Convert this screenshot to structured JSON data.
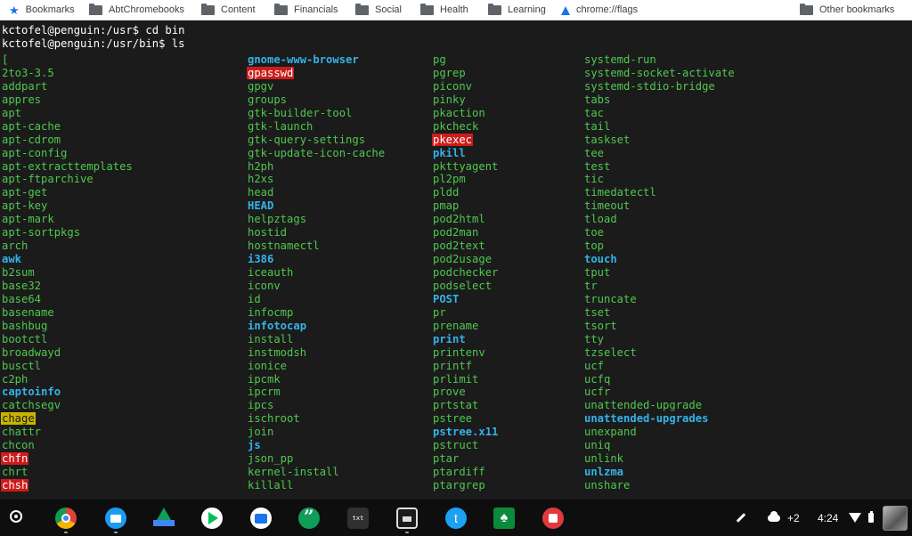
{
  "bookmarks": [
    {
      "label": "Bookmarks",
      "icon": "star-icon"
    },
    {
      "label": "AbtChromebooks",
      "icon": "folder-icon"
    },
    {
      "label": "Content",
      "icon": "folder-icon"
    },
    {
      "label": "Financials",
      "icon": "folder-icon"
    },
    {
      "label": "Social",
      "icon": "folder-icon"
    },
    {
      "label": "Health",
      "icon": "folder-icon"
    },
    {
      "label": "Learning",
      "icon": "folder-icon"
    },
    {
      "label": "chrome://flags",
      "icon": "flask-icon"
    },
    {
      "label": "Other bookmarks",
      "icon": "folder-icon"
    }
  ],
  "terminal": {
    "lines": [
      "kctofel@penguin:/usr$ cd bin",
      "kctofel@penguin:/usr/bin$ ls"
    ],
    "columns": [
      [
        {
          "name": "[",
          "type": "exec"
        },
        {
          "name": "2to3-3.5",
          "type": "exec"
        },
        {
          "name": "addpart",
          "type": "exec"
        },
        {
          "name": "appres",
          "type": "exec"
        },
        {
          "name": "apt",
          "type": "exec"
        },
        {
          "name": "apt-cache",
          "type": "exec"
        },
        {
          "name": "apt-cdrom",
          "type": "exec"
        },
        {
          "name": "apt-config",
          "type": "exec"
        },
        {
          "name": "apt-extracttemplates",
          "type": "exec"
        },
        {
          "name": "apt-ftparchive",
          "type": "exec"
        },
        {
          "name": "apt-get",
          "type": "exec"
        },
        {
          "name": "apt-key",
          "type": "exec"
        },
        {
          "name": "apt-mark",
          "type": "exec"
        },
        {
          "name": "apt-sortpkgs",
          "type": "exec"
        },
        {
          "name": "arch",
          "type": "exec"
        },
        {
          "name": "awk",
          "type": "link"
        },
        {
          "name": "b2sum",
          "type": "exec"
        },
        {
          "name": "base32",
          "type": "exec"
        },
        {
          "name": "base64",
          "type": "exec"
        },
        {
          "name": "basename",
          "type": "exec"
        },
        {
          "name": "bashbug",
          "type": "exec"
        },
        {
          "name": "bootctl",
          "type": "exec"
        },
        {
          "name": "broadwayd",
          "type": "exec"
        },
        {
          "name": "busctl",
          "type": "exec"
        },
        {
          "name": "c2ph",
          "type": "exec"
        },
        {
          "name": "captoinfo",
          "type": "link"
        },
        {
          "name": "catchsegv",
          "type": "exec"
        },
        {
          "name": "chage",
          "type": "sgid"
        },
        {
          "name": "chattr",
          "type": "exec"
        },
        {
          "name": "chcon",
          "type": "exec"
        },
        {
          "name": "chfn",
          "type": "suid"
        },
        {
          "name": "chrt",
          "type": "exec"
        },
        {
          "name": "chsh",
          "type": "suid"
        }
      ],
      [
        {
          "name": "gnome-www-browser",
          "type": "link"
        },
        {
          "name": "gpasswd",
          "type": "suid"
        },
        {
          "name": "gpgv",
          "type": "exec"
        },
        {
          "name": "groups",
          "type": "exec"
        },
        {
          "name": "gtk-builder-tool",
          "type": "exec"
        },
        {
          "name": "gtk-launch",
          "type": "exec"
        },
        {
          "name": "gtk-query-settings",
          "type": "exec"
        },
        {
          "name": "gtk-update-icon-cache",
          "type": "exec"
        },
        {
          "name": "h2ph",
          "type": "exec"
        },
        {
          "name": "h2xs",
          "type": "exec"
        },
        {
          "name": "head",
          "type": "exec"
        },
        {
          "name": "HEAD",
          "type": "link"
        },
        {
          "name": "helpztags",
          "type": "exec"
        },
        {
          "name": "hostid",
          "type": "exec"
        },
        {
          "name": "hostnamectl",
          "type": "exec"
        },
        {
          "name": "i386",
          "type": "link"
        },
        {
          "name": "iceauth",
          "type": "exec"
        },
        {
          "name": "iconv",
          "type": "exec"
        },
        {
          "name": "id",
          "type": "exec"
        },
        {
          "name": "infocmp",
          "type": "exec"
        },
        {
          "name": "infotocap",
          "type": "link"
        },
        {
          "name": "install",
          "type": "exec"
        },
        {
          "name": "instmodsh",
          "type": "exec"
        },
        {
          "name": "ionice",
          "type": "exec"
        },
        {
          "name": "ipcmk",
          "type": "exec"
        },
        {
          "name": "ipcrm",
          "type": "exec"
        },
        {
          "name": "ipcs",
          "type": "exec"
        },
        {
          "name": "ischroot",
          "type": "exec"
        },
        {
          "name": "join",
          "type": "exec"
        },
        {
          "name": "js",
          "type": "link"
        },
        {
          "name": "json_pp",
          "type": "exec"
        },
        {
          "name": "kernel-install",
          "type": "exec"
        },
        {
          "name": "killall",
          "type": "exec"
        }
      ],
      [
        {
          "name": "pg",
          "type": "exec"
        },
        {
          "name": "pgrep",
          "type": "exec"
        },
        {
          "name": "piconv",
          "type": "exec"
        },
        {
          "name": "pinky",
          "type": "exec"
        },
        {
          "name": "pkaction",
          "type": "exec"
        },
        {
          "name": "pkcheck",
          "type": "exec"
        },
        {
          "name": "pkexec",
          "type": "suid"
        },
        {
          "name": "pkill",
          "type": "link"
        },
        {
          "name": "pkttyagent",
          "type": "exec"
        },
        {
          "name": "pl2pm",
          "type": "exec"
        },
        {
          "name": "pldd",
          "type": "exec"
        },
        {
          "name": "pmap",
          "type": "exec"
        },
        {
          "name": "pod2html",
          "type": "exec"
        },
        {
          "name": "pod2man",
          "type": "exec"
        },
        {
          "name": "pod2text",
          "type": "exec"
        },
        {
          "name": "pod2usage",
          "type": "exec"
        },
        {
          "name": "podchecker",
          "type": "exec"
        },
        {
          "name": "podselect",
          "type": "exec"
        },
        {
          "name": "POST",
          "type": "link"
        },
        {
          "name": "pr",
          "type": "exec"
        },
        {
          "name": "prename",
          "type": "exec"
        },
        {
          "name": "print",
          "type": "link"
        },
        {
          "name": "printenv",
          "type": "exec"
        },
        {
          "name": "printf",
          "type": "exec"
        },
        {
          "name": "prlimit",
          "type": "exec"
        },
        {
          "name": "prove",
          "type": "exec"
        },
        {
          "name": "prtstat",
          "type": "exec"
        },
        {
          "name": "pstree",
          "type": "exec"
        },
        {
          "name": "pstree.x11",
          "type": "link"
        },
        {
          "name": "pstruct",
          "type": "exec"
        },
        {
          "name": "ptar",
          "type": "exec"
        },
        {
          "name": "ptardiff",
          "type": "exec"
        },
        {
          "name": "ptargrep",
          "type": "exec"
        }
      ],
      [
        {
          "name": "systemd-run",
          "type": "exec"
        },
        {
          "name": "systemd-socket-activate",
          "type": "exec"
        },
        {
          "name": "systemd-stdio-bridge",
          "type": "exec"
        },
        {
          "name": "tabs",
          "type": "exec"
        },
        {
          "name": "tac",
          "type": "exec"
        },
        {
          "name": "tail",
          "type": "exec"
        },
        {
          "name": "taskset",
          "type": "exec"
        },
        {
          "name": "tee",
          "type": "exec"
        },
        {
          "name": "test",
          "type": "exec"
        },
        {
          "name": "tic",
          "type": "exec"
        },
        {
          "name": "timedatectl",
          "type": "exec"
        },
        {
          "name": "timeout",
          "type": "exec"
        },
        {
          "name": "tload",
          "type": "exec"
        },
        {
          "name": "toe",
          "type": "exec"
        },
        {
          "name": "top",
          "type": "exec"
        },
        {
          "name": "touch",
          "type": "link"
        },
        {
          "name": "tput",
          "type": "exec"
        },
        {
          "name": "tr",
          "type": "exec"
        },
        {
          "name": "truncate",
          "type": "exec"
        },
        {
          "name": "tset",
          "type": "exec"
        },
        {
          "name": "tsort",
          "type": "exec"
        },
        {
          "name": "tty",
          "type": "exec"
        },
        {
          "name": "tzselect",
          "type": "exec"
        },
        {
          "name": "ucf",
          "type": "exec"
        },
        {
          "name": "ucfq",
          "type": "exec"
        },
        {
          "name": "ucfr",
          "type": "exec"
        },
        {
          "name": "unattended-upgrade",
          "type": "exec"
        },
        {
          "name": "unattended-upgrades",
          "type": "link"
        },
        {
          "name": "unexpand",
          "type": "exec"
        },
        {
          "name": "uniq",
          "type": "exec"
        },
        {
          "name": "unlink",
          "type": "exec"
        },
        {
          "name": "unlzma",
          "type": "link"
        },
        {
          "name": "unshare",
          "type": "exec"
        }
      ]
    ]
  },
  "colors": {
    "terminal_bg": "#1b1b1b",
    "executable": "#4fc84f",
    "symlink": "#33b3e8",
    "suid_bg": "#cc1c1c",
    "sgid_bg": "#c8b400"
  },
  "shelf": {
    "apps": [
      {
        "name": "chrome-icon"
      },
      {
        "name": "files-icon"
      },
      {
        "name": "google-drive-icon"
      },
      {
        "name": "play-store-icon"
      },
      {
        "name": "camera-icon"
      },
      {
        "name": "hangouts-icon"
      },
      {
        "name": "text-editor-icon",
        "label": "txt"
      },
      {
        "name": "printer-icon"
      },
      {
        "name": "twitter-icon",
        "label": "t"
      },
      {
        "name": "solitaire-icon",
        "label": "♠"
      },
      {
        "name": "image-app-icon"
      }
    ],
    "status": {
      "notification_count": "+2",
      "time": "4:24"
    }
  }
}
